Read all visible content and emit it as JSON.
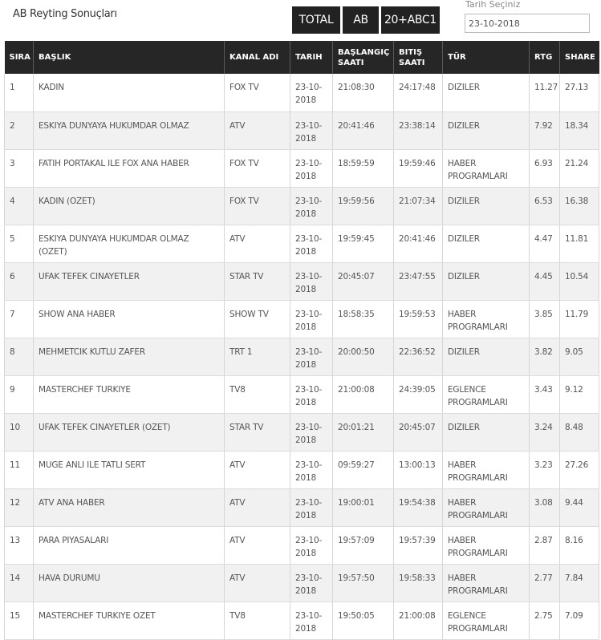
{
  "page": {
    "title": "AB Reyting Sonuçları"
  },
  "tabs": [
    "TOTAL",
    "AB",
    "20+ABC1"
  ],
  "date_picker": {
    "label": "Tarih Seçiniz",
    "value": "23-10-2018"
  },
  "table": {
    "headers": [
      "SIRA",
      "BAŞLIK",
      "KANAL ADI",
      "TARIH",
      "BAŞLANGIÇ SAATI",
      "BITIŞ SAATI",
      "TÜR",
      "RTG",
      "SHARE"
    ],
    "rows": [
      [
        "1",
        "KADIN",
        "FOX TV",
        "23-10-2018",
        "21:08:30",
        "24:17:48",
        "DIZILER",
        "11.27",
        "27.13"
      ],
      [
        "2",
        "ESKIYA DUNYAYA HUKUMDAR OLMAZ",
        "ATV",
        "23-10-2018",
        "20:41:46",
        "23:38:14",
        "DIZILER",
        "7.92",
        "18.34"
      ],
      [
        "3",
        "FATIH PORTAKAL ILE FOX ANA HABER",
        "FOX TV",
        "23-10-2018",
        "18:59:59",
        "19:59:46",
        "HABER PROGRAMLARI",
        "6.93",
        "21.24"
      ],
      [
        "4",
        "KADIN (OZET)",
        "FOX TV",
        "23-10-2018",
        "19:59:56",
        "21:07:34",
        "DIZILER",
        "6.53",
        "16.38"
      ],
      [
        "5",
        "ESKIYA DUNYAYA HUKUMDAR OLMAZ (OZET)",
        "ATV",
        "23-10-2018",
        "19:59:45",
        "20:41:46",
        "DIZILER",
        "4.47",
        "11.81"
      ],
      [
        "6",
        "UFAK TEFEK CINAYETLER",
        "STAR TV",
        "23-10-2018",
        "20:45:07",
        "23:47:55",
        "DIZILER",
        "4.45",
        "10.54"
      ],
      [
        "7",
        "SHOW ANA HABER",
        "SHOW TV",
        "23-10-2018",
        "18:58:35",
        "19:59:53",
        "HABER PROGRAMLARI",
        "3.85",
        "11.79"
      ],
      [
        "8",
        "MEHMETCIK KUTLU ZAFER",
        "TRT 1",
        "23-10-2018",
        "20:00:50",
        "22:36:52",
        "DIZILER",
        "3.82",
        "9.05"
      ],
      [
        "9",
        "MASTERCHEF TURKIYE",
        "TV8",
        "23-10-2018",
        "21:00:08",
        "24:39:05",
        "EGLENCE PROGRAMLARI",
        "3.43",
        "9.12"
      ],
      [
        "10",
        "UFAK TEFEK CINAYETLER (OZET)",
        "STAR TV",
        "23-10-2018",
        "20:01:21",
        "20:45:07",
        "DIZILER",
        "3.24",
        "8.48"
      ],
      [
        "11",
        "MUGE ANLI ILE TATLI SERT",
        "ATV",
        "23-10-2018",
        "09:59:27",
        "13:00:13",
        "HABER PROGRAMLARI",
        "3.23",
        "27.26"
      ],
      [
        "12",
        "ATV ANA HABER",
        "ATV",
        "23-10-2018",
        "19:00:01",
        "19:54:38",
        "HABER PROGRAMLARI",
        "3.08",
        "9.44"
      ],
      [
        "13",
        "PARA PIYASALARI",
        "ATV",
        "23-10-2018",
        "19:57:09",
        "19:57:39",
        "HABER PROGRAMLARI",
        "2.87",
        "8.16"
      ],
      [
        "14",
        "HAVA DURUMU",
        "ATV",
        "23-10-2018",
        "19:57:50",
        "19:58:33",
        "HABER PROGRAMLARI",
        "2.77",
        "7.84"
      ],
      [
        "15",
        "MASTERCHEF TURKIYE OZET",
        "TV8",
        "23-10-2018",
        "19:50:05",
        "21:00:08",
        "EGLENCE PROGRAMLARI",
        "2.75",
        "7.09"
      ]
    ]
  }
}
